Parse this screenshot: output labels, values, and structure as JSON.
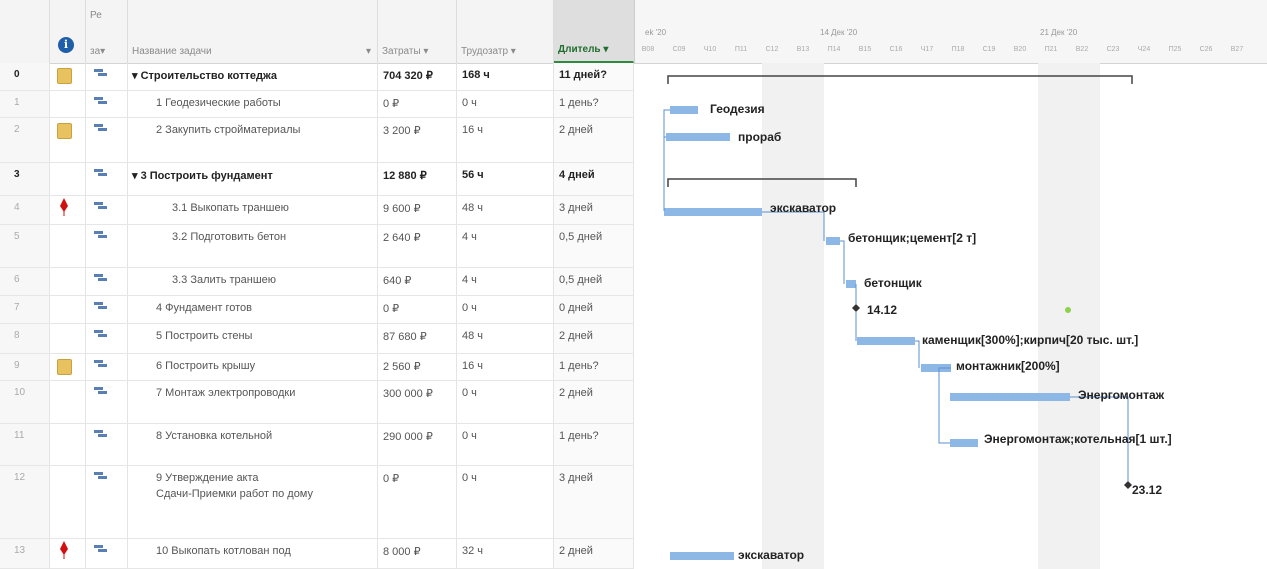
{
  "columns": {
    "indicator_icon": "info-icon",
    "mode_top": "Ре",
    "mode": "за▾",
    "name": "Название задачи",
    "cost": "Затраты ▾",
    "work": "Трудозатр ▾",
    "duration": "Длитель ▾"
  },
  "timescale": {
    "weeks": [
      "ek '20",
      "14 Дек '20",
      "21 Дек '20"
    ],
    "days": [
      "В08",
      "С09",
      "Ч10",
      "П11",
      "С12",
      "В13",
      "П14",
      "В15",
      "С16",
      "Ч17",
      "П18",
      "С19",
      "В20",
      "П21",
      "В22",
      "С23",
      "Ч24",
      "П25",
      "С26",
      "В27"
    ]
  },
  "rows": [
    {
      "id": "0",
      "name": "▾ Строительство коттеджа",
      "cost": "704 320 ₽",
      "work": "168 ч",
      "duration": "11 дней?",
      "bold": true,
      "note": true,
      "flag": false
    },
    {
      "id": "1",
      "name": "1 Геодезические работы",
      "cost": "0 ₽",
      "work": "0 ч",
      "duration": "1 день?",
      "bold": false,
      "note": false,
      "flag": false
    },
    {
      "id": "2",
      "name": "2 Закупить стройматериалы",
      "cost": "3 200 ₽",
      "work": "16 ч",
      "duration": "2 дней",
      "bold": false,
      "note": true,
      "flag": false
    },
    {
      "id": "3",
      "name": "▾ 3 Построить фундамент",
      "cost": "12 880 ₽",
      "work": "56 ч",
      "duration": "4 дней",
      "bold": true,
      "note": false,
      "flag": false
    },
    {
      "id": "4",
      "name": "3.1 Выкопать траншею",
      "cost": "9 600 ₽",
      "work": "48 ч",
      "duration": "3 дней",
      "bold": false,
      "note": false,
      "flag": true
    },
    {
      "id": "5",
      "name": "3.2 Подготовить бетон",
      "cost": "2 640 ₽",
      "work": "4 ч",
      "duration": "0,5 дней",
      "bold": false,
      "note": false,
      "flag": false
    },
    {
      "id": "6",
      "name": "3.3 Залить траншею",
      "cost": "640 ₽",
      "work": "4 ч",
      "duration": "0,5 дней",
      "bold": false,
      "note": false,
      "flag": false
    },
    {
      "id": "7",
      "name": "4 Фундамент готов",
      "cost": "0 ₽",
      "work": "0 ч",
      "duration": "0 дней",
      "bold": false,
      "note": false,
      "flag": false
    },
    {
      "id": "8",
      "name": "5 Построить стены",
      "cost": "87 680 ₽",
      "work": "48 ч",
      "duration": "2 дней",
      "bold": false,
      "note": false,
      "flag": false
    },
    {
      "id": "9",
      "name": "6 Построить крышу",
      "cost": "2 560 ₽",
      "work": "16 ч",
      "duration": "1 день?",
      "bold": false,
      "note": true,
      "flag": false
    },
    {
      "id": "10",
      "name": "7 Монтаж электропроводки",
      "cost": "300 000 ₽",
      "work": "0 ч",
      "duration": "2 дней",
      "bold": false,
      "note": false,
      "flag": false
    },
    {
      "id": "11",
      "name": "8 Установка котельной",
      "cost": "290 000 ₽",
      "work": "0 ч",
      "duration": "1 день?",
      "bold": false,
      "note": false,
      "flag": false
    },
    {
      "id": "12",
      "name": "9 Утверждение акта",
      "name2": "Сдачи-Приемки работ по дому",
      "cost": "0 ₽",
      "work": "0 ч",
      "duration": "3 дней",
      "bold": false,
      "note": false,
      "flag": false
    },
    {
      "id": "13",
      "name": "10 Выкопать котлован под",
      "cost": "8 000 ₽",
      "work": "32 ч",
      "duration": "2 дней",
      "bold": false,
      "note": false,
      "flag": true
    }
  ],
  "gantt_labels": [
    "Геодезия",
    "прораб",
    "экскаватор",
    "бетонщик;цемент[2 т]",
    "бетонщик",
    "14.12",
    "каменщик[300%];кирпич[20 тыс. шт.]",
    "монтажник[200%]",
    "Энергомонтаж",
    "Энергомонтаж;котельная[1 шт.]",
    "23.12",
    "экскаватор"
  ],
  "colors": {
    "bar": "#8db8e6",
    "summary": "#444444",
    "active_header": "#2e8b3e",
    "flag": "#d01010",
    "note": "#e8c25e",
    "mode_icon": "#5a7fb5"
  }
}
